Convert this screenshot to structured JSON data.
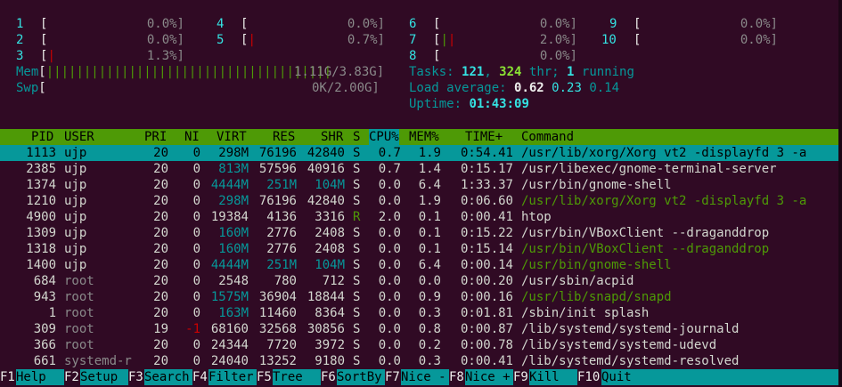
{
  "cpus": [
    {
      "id": "1",
      "pct": "0.0%]"
    },
    {
      "id": "2",
      "pct": "0.0%]"
    },
    {
      "id": "3",
      "pct": "1.3%]"
    },
    {
      "id": "4",
      "pct": "0.0%]"
    },
    {
      "id": "5",
      "pct": "0.7%]"
    },
    {
      "id": "6",
      "pct": "0.0%]"
    },
    {
      "id": "7",
      "pct": "2.0%]"
    },
    {
      "id": "8",
      "pct": "0.0%]"
    },
    {
      "id": "9",
      "pct": "0.0%]"
    },
    {
      "id": "10",
      "pct": "0.0%]"
    }
  ],
  "mem": {
    "label": "Mem",
    "bars": "||||||||||||||||||||||||||||||||||||||",
    "value": "1.11G/3.83G]"
  },
  "swp": {
    "label": "Swp",
    "value": "0K/2.00G]"
  },
  "tasks": {
    "label": "Tasks: ",
    "count": "121",
    "sep": ", ",
    "thr": "324",
    "thr_label": " thr; ",
    "running": "1",
    "running_label": " running"
  },
  "load": {
    "label": "Load average: ",
    "v1": "0.62",
    "v2": "0.23",
    "v3": "0.14"
  },
  "uptime": {
    "label": "Uptime: ",
    "value": "01:43:09"
  },
  "columns": {
    "pid": "PID",
    "user": "USER",
    "pri": "PRI",
    "ni": "NI",
    "virt": "VIRT",
    "res": "RES",
    "shr": "SHR",
    "s": "S",
    "cpu": "CPU%",
    "mem": "MEM%",
    "time": "TIME+",
    "command": "Command"
  },
  "processes": [
    {
      "pid": "1113",
      "user": "ujp",
      "pri": "20",
      "ni": "0",
      "virt": "298M",
      "res": "76196",
      "shr": "42840",
      "s": "S",
      "cpu": "0.7",
      "mem": "1.9",
      "time": "0:54.41",
      "cmd": "/usr/lib/xorg/Xorg vt2 -displayfd 3 -a"
    },
    {
      "pid": "2385",
      "user": "ujp",
      "pri": "20",
      "ni": "0",
      "virt": "813M",
      "res": "57596",
      "shr": "40916",
      "s": "S",
      "cpu": "0.7",
      "mem": "1.4",
      "time": "0:15.17",
      "cmd": "/usr/libexec/gnome-terminal-server"
    },
    {
      "pid": "1374",
      "user": "ujp",
      "pri": "20",
      "ni": "0",
      "virt": "4444M",
      "res": "251M",
      "shr": "104M",
      "s": "S",
      "cpu": "0.0",
      "mem": "6.4",
      "time": "1:33.37",
      "cmd": "/usr/bin/gnome-shell"
    },
    {
      "pid": "1210",
      "user": "ujp",
      "pri": "20",
      "ni": "0",
      "virt": "298M",
      "res": "76196",
      "shr": "42840",
      "s": "S",
      "cpu": "0.0",
      "mem": "1.9",
      "time": "0:06.60",
      "cmd": "/usr/lib/xorg/Xorg vt2 -displayfd 3 -a"
    },
    {
      "pid": "4900",
      "user": "ujp",
      "pri": "20",
      "ni": "0",
      "virt": "19384",
      "res": "4136",
      "shr": "3316",
      "s": "R",
      "cpu": "2.0",
      "mem": "0.1",
      "time": "0:00.41",
      "cmd": "htop"
    },
    {
      "pid": "1309",
      "user": "ujp",
      "pri": "20",
      "ni": "0",
      "virt": "160M",
      "res": "2776",
      "shr": "2408",
      "s": "S",
      "cpu": "0.0",
      "mem": "0.1",
      "time": "0:15.22",
      "cmd": "/usr/bin/VBoxClient --draganddrop"
    },
    {
      "pid": "1318",
      "user": "ujp",
      "pri": "20",
      "ni": "0",
      "virt": "160M",
      "res": "2776",
      "shr": "2408",
      "s": "S",
      "cpu": "0.0",
      "mem": "0.1",
      "time": "0:15.14",
      "cmd": "/usr/bin/VBoxClient --draganddrop"
    },
    {
      "pid": "1400",
      "user": "ujp",
      "pri": "20",
      "ni": "0",
      "virt": "4444M",
      "res": "251M",
      "shr": "104M",
      "s": "S",
      "cpu": "0.0",
      "mem": "6.4",
      "time": "0:00.14",
      "cmd": "/usr/bin/gnome-shell"
    },
    {
      "pid": "684",
      "user": "root",
      "pri": "20",
      "ni": "0",
      "virt": "2548",
      "res": "780",
      "shr": "712",
      "s": "S",
      "cpu": "0.0",
      "mem": "0.0",
      "time": "0:00.20",
      "cmd": "/usr/sbin/acpid"
    },
    {
      "pid": "943",
      "user": "root",
      "pri": "20",
      "ni": "0",
      "virt": "1575M",
      "res": "36904",
      "shr": "18844",
      "s": "S",
      "cpu": "0.0",
      "mem": "0.9",
      "time": "0:00.16",
      "cmd": "/usr/lib/snapd/snapd"
    },
    {
      "pid": "1",
      "user": "root",
      "pri": "20",
      "ni": "0",
      "virt": "163M",
      "res": "11460",
      "shr": "8364",
      "s": "S",
      "cpu": "0.0",
      "mem": "0.3",
      "time": "0:01.81",
      "cmd": "/sbin/init splash"
    },
    {
      "pid": "309",
      "user": "root",
      "pri": "19",
      "ni": "-1",
      "virt": "68160",
      "res": "32568",
      "shr": "30856",
      "s": "S",
      "cpu": "0.0",
      "mem": "0.8",
      "time": "0:00.87",
      "cmd": "/lib/systemd/systemd-journald"
    },
    {
      "pid": "366",
      "user": "root",
      "pri": "20",
      "ni": "0",
      "virt": "24344",
      "res": "7720",
      "shr": "3972",
      "s": "S",
      "cpu": "0.0",
      "mem": "0.2",
      "time": "0:00.78",
      "cmd": "/lib/systemd/systemd-udevd"
    },
    {
      "pid": "661",
      "user": "systemd-r",
      "pri": "20",
      "ni": "0",
      "virt": "24040",
      "res": "13252",
      "shr": "9180",
      "s": "S",
      "cpu": "0.0",
      "mem": "0.3",
      "time": "0:00.41",
      "cmd": "/lib/systemd/systemd-resolved"
    }
  ],
  "fkeys": [
    {
      "key": "F1",
      "label": "Help  "
    },
    {
      "key": "F2",
      "label": "Setup "
    },
    {
      "key": "F3",
      "label": "Search"
    },
    {
      "key": "F4",
      "label": "Filter"
    },
    {
      "key": "F5",
      "label": "Tree  "
    },
    {
      "key": "F6",
      "label": "SortBy"
    },
    {
      "key": "F7",
      "label": "Nice -"
    },
    {
      "key": "F8",
      "label": "Nice +"
    },
    {
      "key": "F9",
      "label": "Kill  "
    },
    {
      "key": "F10",
      "label": "Quit"
    }
  ]
}
